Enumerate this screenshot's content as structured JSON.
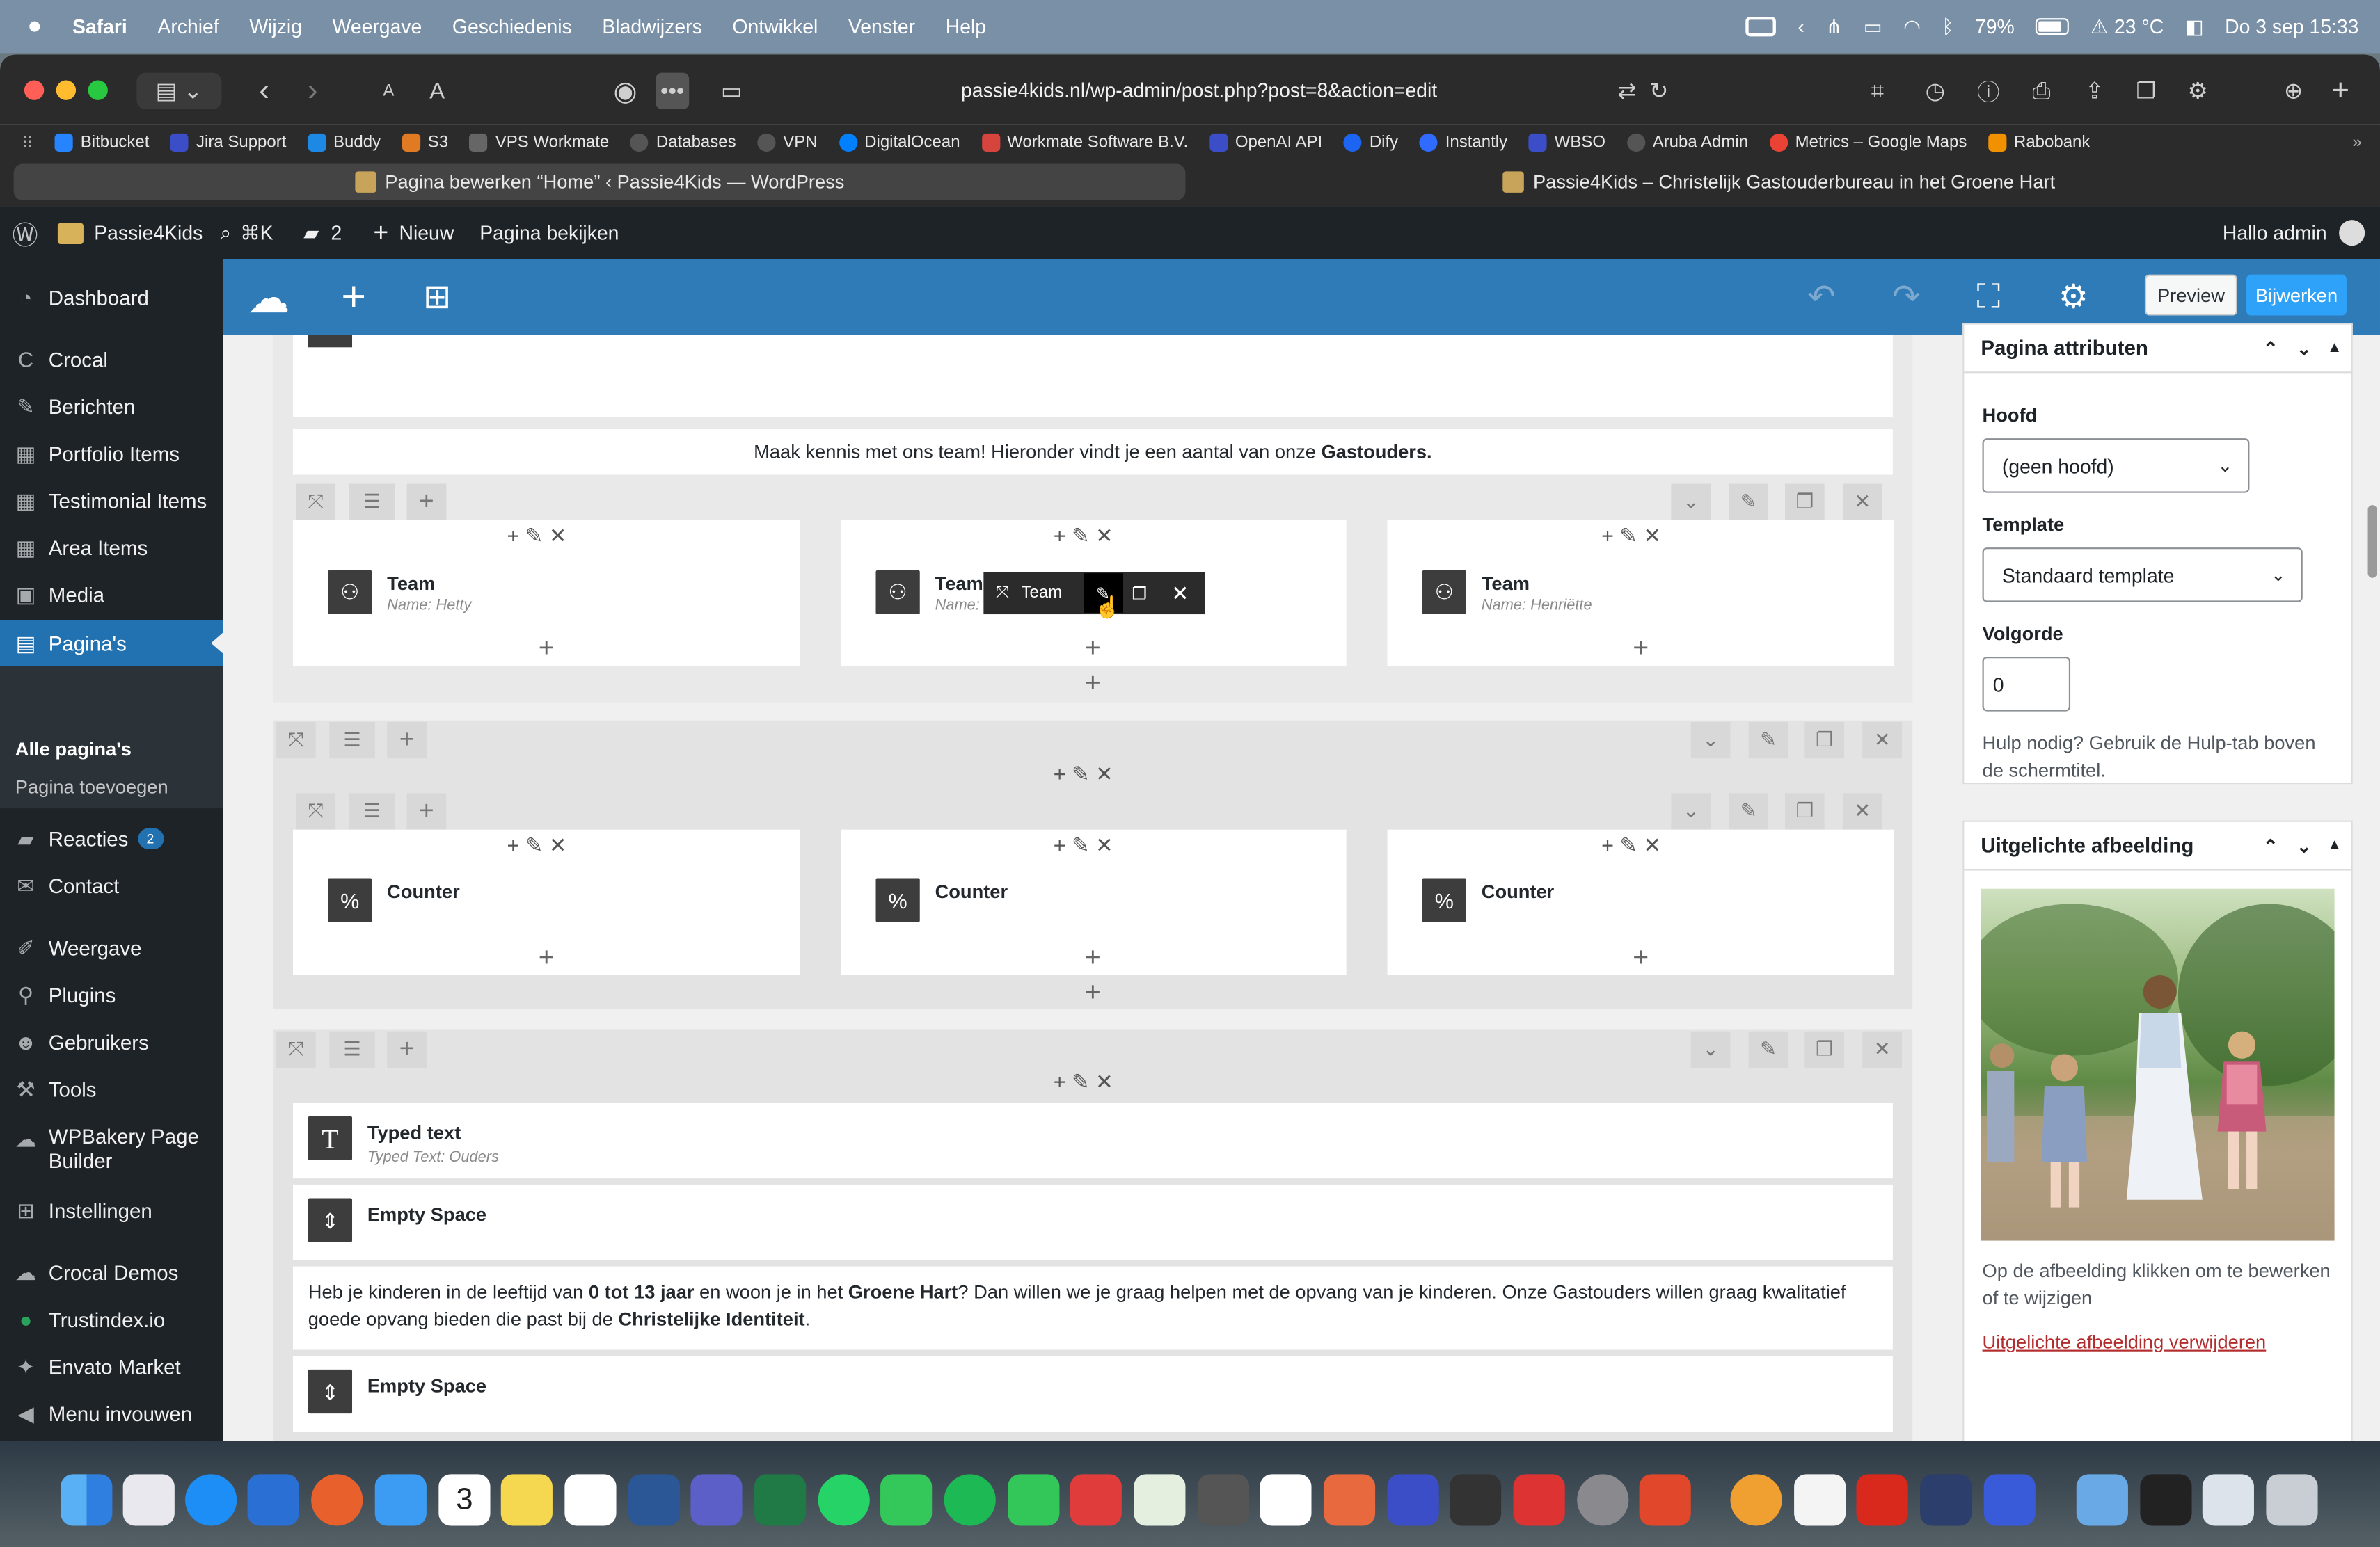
{
  "menubar": {
    "app": "Safari",
    "items": [
      "Archief",
      "Wijzig",
      "Weergave",
      "Geschiedenis",
      "Bladwijzers",
      "Ontwikkel",
      "Venster",
      "Help"
    ],
    "battery": "79%",
    "weather": "23 °C",
    "datetime": "Do 3 sep  15:33"
  },
  "browser": {
    "url": "passie4kids.nl/wp-admin/post.php?post=8&action=edit",
    "favorites": [
      "Bitbucket",
      "Jira Support",
      "Buddy",
      "S3",
      "VPS Workmate",
      "Databases",
      "VPN",
      "DigitalOcean",
      "Workmate Software B.V.",
      "OpenAI API",
      "Dify",
      "Instantly",
      "WBSO",
      "Aruba Admin",
      "Metrics – Google Maps",
      "Rabobank"
    ],
    "tabs": [
      "Pagina bewerken “Home” ‹ Passie4Kids — WordPress",
      "Passie4Kids – Christelijk Gastouderbureau in het Groene Hart"
    ]
  },
  "adminbar": {
    "site": "Passie4Kids",
    "search_shortcut": "⌘K",
    "comments": "2",
    "new": "Nieuw",
    "view": "Pagina bekijken",
    "greeting": "Hallo admin"
  },
  "sidemenu": {
    "items": [
      "Dashboard",
      "Crocal",
      "Berichten",
      "Portfolio Items",
      "Testimonial Items",
      "Area Items",
      "Media",
      "Pagina's",
      "Reacties",
      "Contact",
      "Weergave",
      "Plugins",
      "Gebruikers",
      "Tools",
      "WPBakery Page Builder",
      "Instellingen",
      "Crocal Demos",
      "Trustindex.io",
      "Envato Market",
      "Menu invouwen"
    ],
    "reacties_badge": "2",
    "subitems": [
      "Alle pagina's",
      "Pagina toevoegen"
    ]
  },
  "vcbar": {
    "preview": "Preview",
    "update": "Bijwerken"
  },
  "editor": {
    "intro_text_a": "Maak kennis met ons team! Hieronder vindt je een aantal van onze ",
    "intro_text_b": "Gastouders.",
    "team": [
      {
        "title": "Team",
        "sub": "Name: Hetty"
      },
      {
        "title": "Team",
        "sub": "Name:"
      },
      {
        "title": "Team",
        "sub": "Name: Henriëtte"
      }
    ],
    "hover_label": "Team",
    "counters": [
      "Counter",
      "Counter",
      "Counter"
    ],
    "typed_title": "Typed text",
    "typed_sub": "Typed Text: Ouders",
    "empty_space": "Empty Space",
    "paragraph": {
      "p1": "Heb je kinderen in de leeftijd van ",
      "b1": "0 tot 13 jaar",
      "p2": " en woon je in het ",
      "b2": "Groene Hart",
      "p3": "? Dan willen we je graag helpen met de opvang van je kinderen. Onze Gastouders willen graag kwalitatief goede opvang bieden die past bij de ",
      "b3": "Christelijke Identiteit",
      "p4": "."
    }
  },
  "panel": {
    "attr_title": "Pagina attributen",
    "parent_label": "Hoofd",
    "parent_value": "(geen hoofd)",
    "template_label": "Template",
    "template_value": "Standaard template",
    "order_label": "Volgorde",
    "order_value": "0",
    "help_text": "Hulp nodig? Gebruik de Hulp-tab boven de schermtitel.",
    "featured_title": "Uitgelichte afbeelding",
    "featured_hint": "Op de afbeelding klikken om te bewerken of te wijzigen",
    "featured_remove": "Uitgelichte afbeelding verwijderen"
  },
  "dock": {
    "calendar_day": "3"
  }
}
